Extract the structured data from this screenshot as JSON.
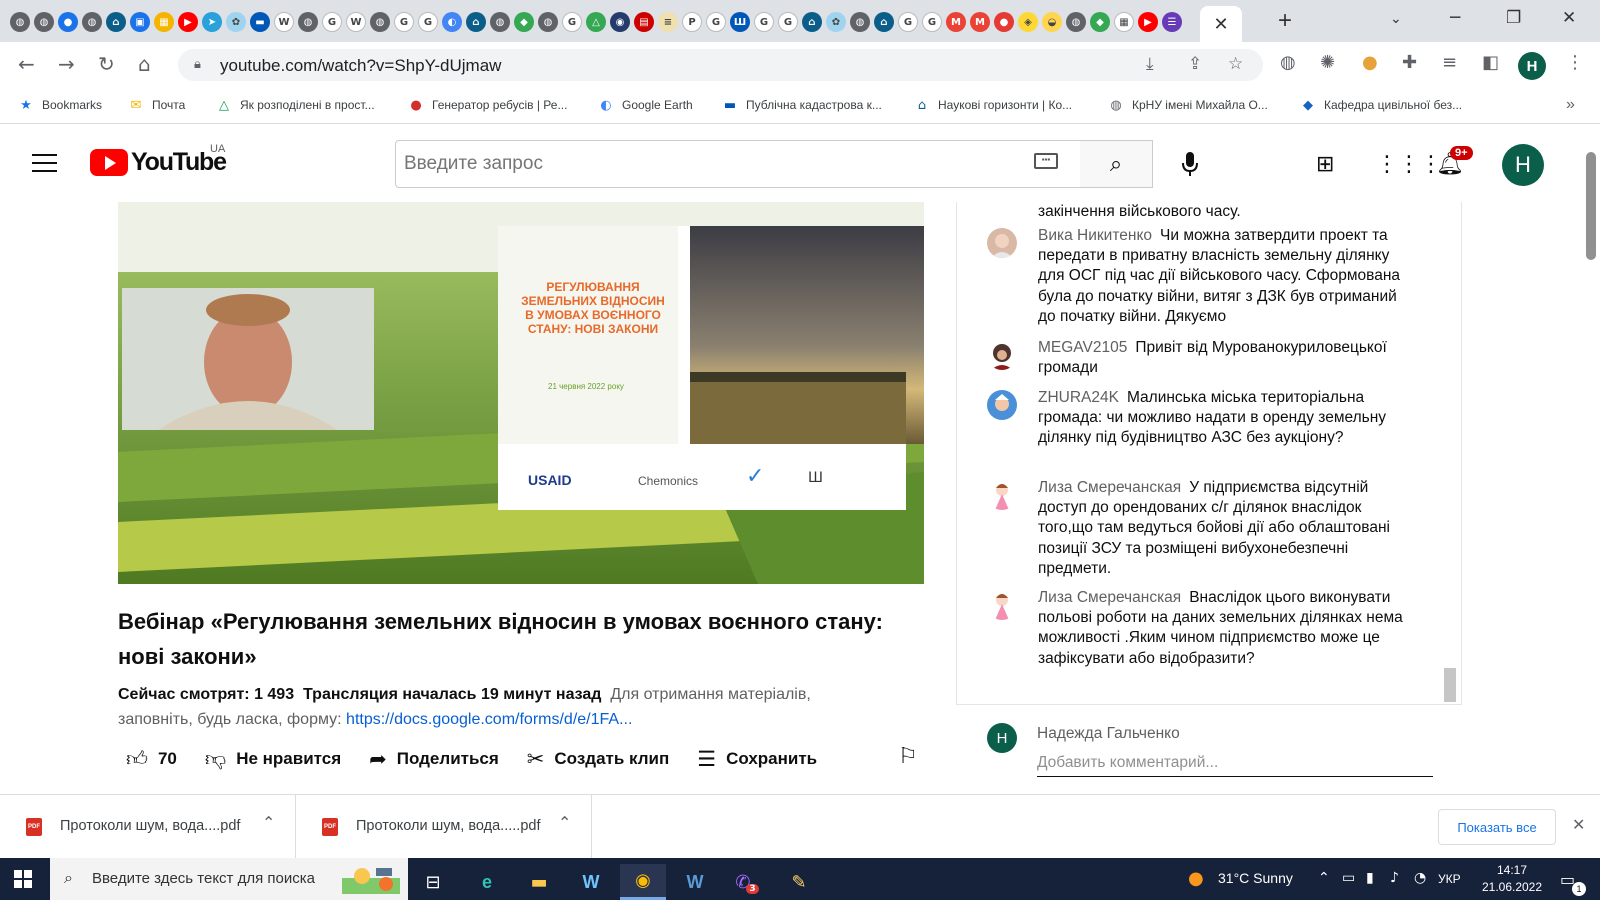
{
  "browser": {
    "tab_favicons": [
      {
        "name": "globe",
        "color": "#5f6368",
        "glyph": "◍"
      },
      {
        "name": "globe",
        "color": "#5f6368",
        "glyph": "◍"
      },
      {
        "name": "account",
        "color": "#1a73e8",
        "glyph": "●"
      },
      {
        "name": "globe",
        "color": "#5f6368",
        "glyph": "◍"
      },
      {
        "name": "site",
        "color": "#0b5e8a",
        "glyph": "⌂"
      },
      {
        "name": "meet",
        "color": "#1a73e8",
        "glyph": "▣"
      },
      {
        "name": "classroom",
        "color": "#f4b400",
        "glyph": "▦"
      },
      {
        "name": "youtube",
        "color": "#ff0000",
        "glyph": "▶"
      },
      {
        "name": "telegram",
        "color": "#2aa1da",
        "glyph": "➤"
      },
      {
        "name": "site",
        "color": "#9fd3ef",
        "glyph": "✿"
      },
      {
        "name": "ukraine",
        "color": "#0057b8",
        "glyph": "▬"
      },
      {
        "name": "wikipedia",
        "color": "#ffffff",
        "glyph": "W"
      },
      {
        "name": "globe",
        "color": "#5f6368",
        "glyph": "◍"
      },
      {
        "name": "google",
        "color": "#ffffff",
        "glyph": "G"
      },
      {
        "name": "wikipedia",
        "color": "#ffffff",
        "glyph": "W"
      },
      {
        "name": "globe",
        "color": "#5f6368",
        "glyph": "◍"
      },
      {
        "name": "google",
        "color": "#ffffff",
        "glyph": "G"
      },
      {
        "name": "google",
        "color": "#ffffff",
        "glyph": "G"
      },
      {
        "name": "earth",
        "color": "#4285f4",
        "glyph": "◐"
      },
      {
        "name": "site",
        "color": "#0b5e8a",
        "glyph": "⌂"
      },
      {
        "name": "globe",
        "color": "#5f6368",
        "glyph": "◍"
      },
      {
        "name": "maps",
        "color": "#34a853",
        "glyph": "◆"
      },
      {
        "name": "globe",
        "color": "#5f6368",
        "glyph": "◍"
      },
      {
        "name": "google",
        "color": "#ffffff",
        "glyph": "G"
      },
      {
        "name": "drive",
        "color": "#34a853",
        "glyph": "△"
      },
      {
        "name": "site",
        "color": "#243b6b",
        "glyph": "◉"
      },
      {
        "name": "site",
        "color": "#cc0000",
        "glyph": "▤"
      },
      {
        "name": "site",
        "color": "#f0e0b0",
        "glyph": "≡"
      },
      {
        "name": "pkr",
        "color": "#ffffff",
        "glyph": "P"
      },
      {
        "name": "google",
        "color": "#ffffff",
        "glyph": "G"
      },
      {
        "name": "trident",
        "color": "#0057b8",
        "glyph": "Ш"
      },
      {
        "name": "google",
        "color": "#ffffff",
        "glyph": "G"
      },
      {
        "name": "google",
        "color": "#ffffff",
        "glyph": "G"
      },
      {
        "name": "site",
        "color": "#0b5e8a",
        "glyph": "⌂"
      },
      {
        "name": "site",
        "color": "#9fd3ef",
        "glyph": "✿"
      },
      {
        "name": "globe",
        "color": "#5f6368",
        "glyph": "◍"
      },
      {
        "name": "site",
        "color": "#0b5e8a",
        "glyph": "⌂"
      },
      {
        "name": "google",
        "color": "#ffffff",
        "glyph": "G"
      },
      {
        "name": "google",
        "color": "#ffffff",
        "glyph": "G"
      },
      {
        "name": "gmail",
        "color": "#ea4335",
        "glyph": "M"
      },
      {
        "name": "gmail",
        "color": "#ea4335",
        "glyph": "M"
      },
      {
        "name": "site",
        "color": "#e53935",
        "glyph": "●"
      },
      {
        "name": "shield",
        "color": "#fdd835",
        "glyph": "◈"
      },
      {
        "name": "site",
        "color": "#ffd54f",
        "glyph": "◒"
      },
      {
        "name": "globe",
        "color": "#5f6368",
        "glyph": "◍"
      },
      {
        "name": "maps",
        "color": "#34a853",
        "glyph": "◆"
      },
      {
        "name": "site",
        "color": "#ffffff",
        "glyph": "▦"
      },
      {
        "name": "youtube",
        "color": "#ff0000",
        "glyph": "▶"
      },
      {
        "name": "forms",
        "color": "#673ab7",
        "glyph": "☰"
      }
    ],
    "active_tab_close": "✕",
    "new_tab": "+",
    "url": "youtube.com/watch?v=ShpY-dUjmaw",
    "bookmarks": [
      {
        "label": "Bookmarks",
        "icon": "star-icon",
        "glyph": "★",
        "color": "#1a73e8"
      },
      {
        "label": "Почта",
        "icon": "mail-icon",
        "glyph": "✉",
        "color": "#f4b400"
      },
      {
        "label": "Як розподілені в прост...",
        "icon": "drive-icon",
        "glyph": "△",
        "color": "#0f9d58"
      },
      {
        "label": "Генератор ребусів | Ре...",
        "icon": "red-ball-icon",
        "glyph": "●",
        "color": "#d32f2f"
      },
      {
        "label": "Google Earth",
        "icon": "earth-icon",
        "glyph": "◐",
        "color": "#4285f4"
      },
      {
        "label": "Публічна кадастрова к...",
        "icon": "ukraine-flag-icon",
        "glyph": "▬",
        "color": "#0057b8"
      },
      {
        "label": "Наукові горизонти | Ко...",
        "icon": "site-icon",
        "glyph": "⌂",
        "color": "#0b5e8a"
      },
      {
        "label": "КрНУ імені Михайла О...",
        "icon": "globe-icon",
        "glyph": "◍",
        "color": "#5f6368"
      },
      {
        "label": "Кафедра цивільної без...",
        "icon": "site-icon",
        "glyph": "◆",
        "color": "#1565c0"
      }
    ],
    "bookmarks_overflow": "»"
  },
  "youtube": {
    "logo_word": "YouTube",
    "region": "UA",
    "search_placeholder": "Введите запрос",
    "notifications_badge": "9+",
    "account_initial": "H"
  },
  "video": {
    "slide_title_lines": [
      "РЕГУЛЮВАННЯ",
      "ЗЕМЕЛЬНИХ ВІДНОСИН",
      "В УМОВАХ ВОЄННОГО",
      "СТАНУ: НОВІ ЗАКОНИ"
    ],
    "slide_date": "21 червня 2022 року",
    "slide_logos": [
      "USAID",
      "Chemonics"
    ],
    "title": "Вебінар «Регулювання земельних відносин в умовах воєнного стану: нові закони»",
    "watching_now": "Сейчас смотрят: 1 493",
    "stream_started": "Трансляция началась 19 минут назад",
    "description": "Для отримання матеріалів, заповніть, будь ласка, форму: ",
    "form_link": "https://docs.google.com/forms/d/e/1FA...",
    "likes": "70",
    "dislike_label": "Не нравится",
    "share_label": "Поделиться",
    "clip_label": "Создать клип",
    "save_label": "Сохранить"
  },
  "chat": {
    "partial_top": "закінчення військового часу.",
    "messages": [
      {
        "author": "Вика Никитенко",
        "text": "Чи можна затвердити проект та передати в приватну власність земельну ділянку для ОСГ під час дії військового часу. Сформована була до початку війни, витяг з ДЗК був отриманий до початку війни. Дякуємо",
        "avatar_color": "#d9b8a6"
      },
      {
        "author": "MEGAV2105",
        "text": "Привіт від Мурованокуриловецької громади",
        "avatar_color": "#4e342e"
      },
      {
        "author": "ZHURA24K",
        "text": "Малинська міська територіальна громада: чи можливо надати в оренду земельну ділянку під будівництво АЗС без аукціону?",
        "avatar_color": "#4a90d9"
      },
      {
        "author": "Лиза Смеречанская",
        "text": "У підприємства відсутній доступ до орендованих с/г ділянок внаслідок того,що там ведуться бойові дії або облаштовані позиції ЗСУ та розміщені вибухонебезпечні предмети.",
        "avatar_color": "#f3e5f5"
      },
      {
        "author": "Лиза Смеречанская",
        "text": "Внаслідок цього виконувати польові роботи на даних земельних ділянках нема можливості .Яким чином підприємство може це зафіксувати або відобразити?",
        "avatar_color": "#f3e5f5"
      }
    ],
    "composer_name": "Надежда Гальченко",
    "composer_placeholder": "Добавить комментарий...",
    "composer_initial": "H"
  },
  "downloads": {
    "items": [
      {
        "filename": "Протоколи шум, вода....pdf"
      },
      {
        "filename": "Протоколи шум, вода.....pdf"
      }
    ],
    "show_all": "Показать все"
  },
  "taskbar": {
    "search_placeholder": "Введите здесь текст для поиска",
    "weather": "31°C  Sunny",
    "language": "УКР",
    "time": "14:17",
    "date": "21.06.2022",
    "notification_count": "1",
    "viber_badge": "3"
  }
}
